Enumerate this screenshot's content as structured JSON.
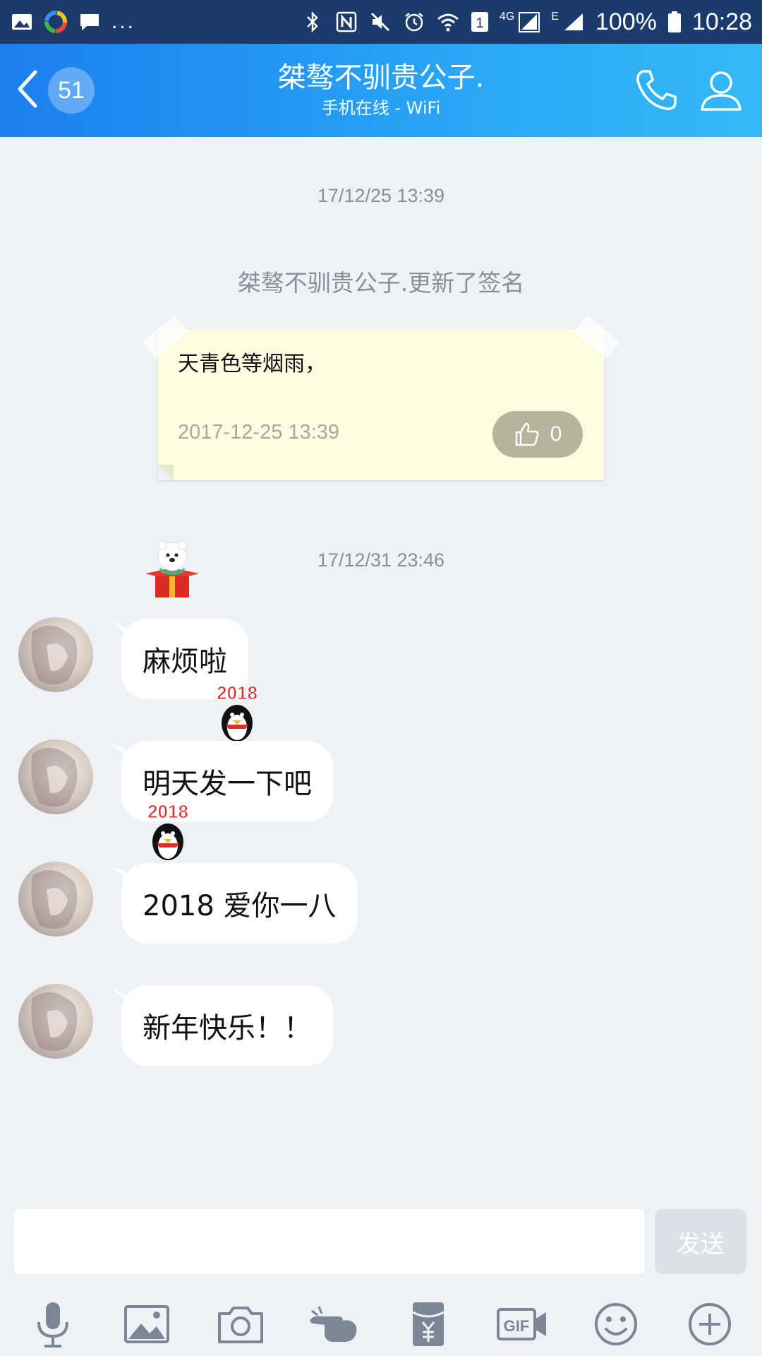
{
  "status_bar": {
    "dots": "...",
    "network_4g": "4G",
    "network_e": "E",
    "sim_slot": "1",
    "battery": "100%",
    "time": "10:28"
  },
  "header": {
    "unread_count": "51",
    "title": "桀骜不驯贵公子.",
    "subtitle": "手机在线 - WiFi",
    "back_icon": "chevron-left-icon",
    "call_icon": "phone-icon",
    "profile_icon": "user-icon"
  },
  "chat": {
    "timestamp_1": "17/12/25 13:39",
    "system_notice": "桀骜不驯贵公子.更新了签名",
    "signature_card": {
      "text": "天青色等烟雨，",
      "date": "2017-12-25 13:39",
      "like_count": "0"
    },
    "timestamp_2": "17/12/31 23:46",
    "messages": [
      {
        "text": "麻烦啦"
      },
      {
        "text": "明天发一下吧"
      },
      {
        "text": "2018 爱你一八"
      },
      {
        "text": "新年快乐！！"
      }
    ]
  },
  "input": {
    "value": "",
    "send_label": "发送"
  },
  "toolbar": {
    "icons": [
      "microphone-icon",
      "image-icon",
      "camera-icon",
      "poke-icon",
      "red-packet-icon",
      "gif-icon",
      "emoji-icon",
      "plus-icon"
    ]
  },
  "colors": {
    "header_start": "#1c7ff0",
    "header_end": "#34b9f7",
    "background": "#eef1f6",
    "card": "#fcfde0"
  }
}
